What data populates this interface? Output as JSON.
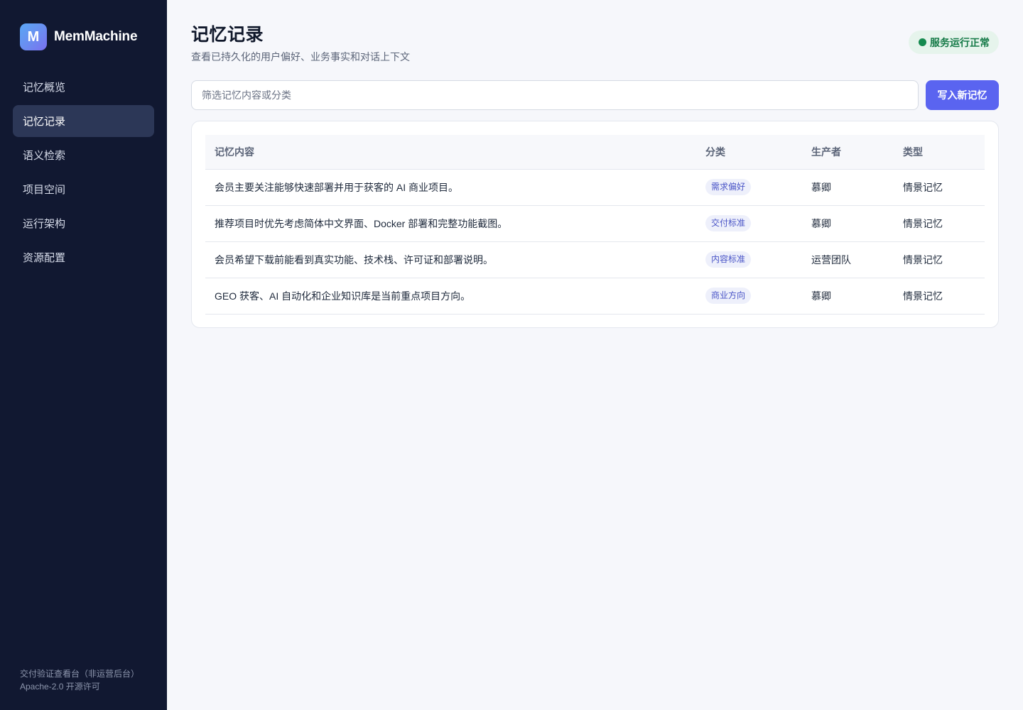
{
  "sidebar": {
    "brand_letter": "M",
    "brand_name": "MemMachine",
    "items": [
      {
        "label": "记忆概览"
      },
      {
        "label": "记忆记录"
      },
      {
        "label": "语义检索"
      },
      {
        "label": "项目空间"
      },
      {
        "label": "运行架构"
      },
      {
        "label": "资源配置"
      }
    ],
    "active_index": 1,
    "footer_line1": "交付验证查看台（非运营后台）",
    "footer_line2": "Apache-2.0 开源许可"
  },
  "header": {
    "title": "记忆记录",
    "subtitle": "查看已持久化的用户偏好、业务事实和对话上下文",
    "status": "服务运行正常"
  },
  "toolbar": {
    "search_placeholder": "筛选记忆内容或分类",
    "search_value": "",
    "write_button": "写入新记忆"
  },
  "table": {
    "headers": [
      "记忆内容",
      "分类",
      "生产者",
      "类型"
    ],
    "rows": [
      {
        "content": "会员主要关注能够快速部署并用于获客的 AI 商业项目。",
        "category": "需求偏好",
        "producer": "慕卿",
        "type": "情景记忆"
      },
      {
        "content": "推荐项目时优先考虑简体中文界面、Docker 部署和完整功能截图。",
        "category": "交付标准",
        "producer": "慕卿",
        "type": "情景记忆"
      },
      {
        "content": "会员希望下载前能看到真实功能、技术栈、许可证和部署说明。",
        "category": "内容标准",
        "producer": "运营团队",
        "type": "情景记忆"
      },
      {
        "content": "GEO 获客、AI 自动化和企业知识库是当前重点项目方向。",
        "category": "商业方向",
        "producer": "慕卿",
        "type": "情景记忆"
      }
    ]
  },
  "colors": {
    "sidebar_bg": "#111831",
    "accent": "#5a64f0",
    "status_green": "#157a47"
  }
}
